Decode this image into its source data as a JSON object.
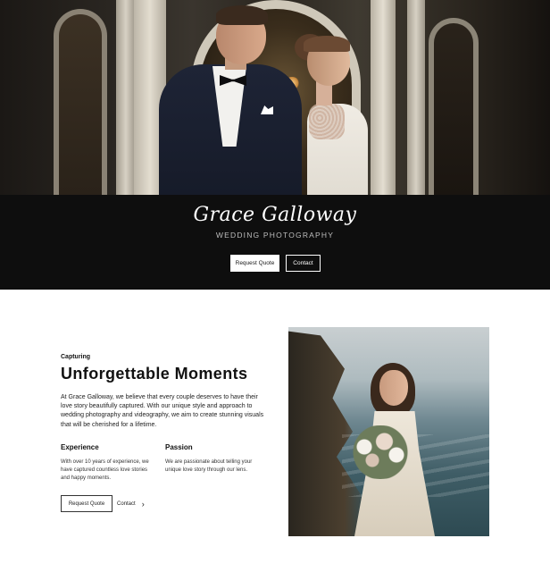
{
  "hero": {
    "brand_name": "Grace Galloway",
    "brand_tagline": "WEDDING PHOTOGRAPHY",
    "request_quote_label": "Request Quote",
    "contact_label": "Contact"
  },
  "intro_section": {
    "eyebrow": "Capturing",
    "headline": "Unforgettable Moments",
    "body": "At Grace Galloway, we believe that every couple deserves to have their love story beautifully captured. With our unique style and approach to wedding photography and videography, we aim to create stunning visuals that will be cherished for a lifetime.",
    "features": [
      {
        "title": "Experience",
        "text": "With over 10 years of experience, we have captured countless love stories and happy moments."
      },
      {
        "title": "Passion",
        "text": "We are passionate about telling your unique love story through our lens."
      }
    ],
    "request_quote_label": "Request Quote",
    "contact_label": "Contact",
    "contact_icon": "chevron-right-icon"
  },
  "colors": {
    "band_background": "#0e0e0e",
    "page_background": "#ffffff",
    "text": "#111111"
  }
}
